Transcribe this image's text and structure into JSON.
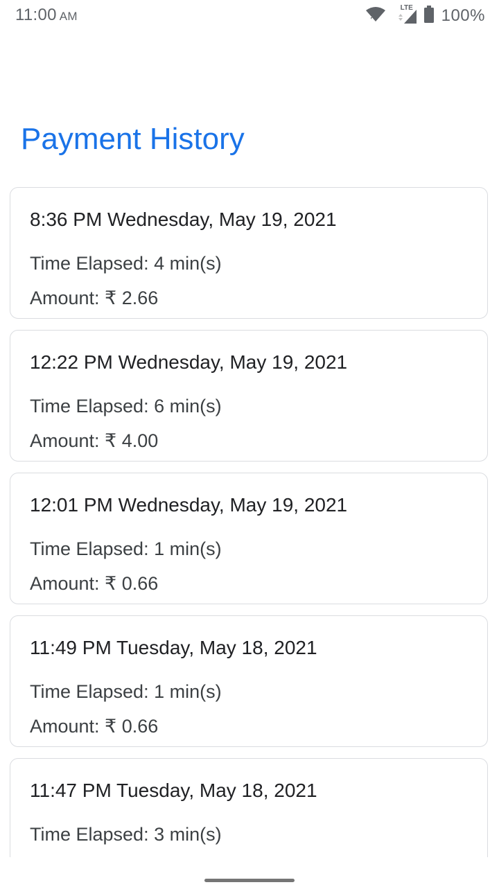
{
  "status_bar": {
    "time": "11:00",
    "ampm": "AM",
    "battery": "100%",
    "network_label": "LTE",
    "icons": [
      "wifi-icon",
      "cell-signal-icon",
      "battery-icon"
    ]
  },
  "page": {
    "title": "Payment History",
    "accent_color": "#1a73e8"
  },
  "payments": [
    {
      "datetime": "8:36 PM Wednesday, May 19, 2021",
      "elapsed": "Time Elapsed: 4 min(s)",
      "amount": "Amount: ₹ 2.66"
    },
    {
      "datetime": "12:22 PM Wednesday, May 19, 2021",
      "elapsed": "Time Elapsed: 6 min(s)",
      "amount": "Amount: ₹ 4.00"
    },
    {
      "datetime": "12:01 PM Wednesday, May 19, 2021",
      "elapsed": "Time Elapsed: 1 min(s)",
      "amount": "Amount: ₹ 0.66"
    },
    {
      "datetime": "11:49 PM Tuesday, May 18, 2021",
      "elapsed": "Time Elapsed: 1 min(s)",
      "amount": "Amount: ₹ 0.66"
    },
    {
      "datetime": "11:47 PM Tuesday, May 18, 2021",
      "elapsed": "Time Elapsed: 3 min(s)",
      "amount": ""
    }
  ]
}
